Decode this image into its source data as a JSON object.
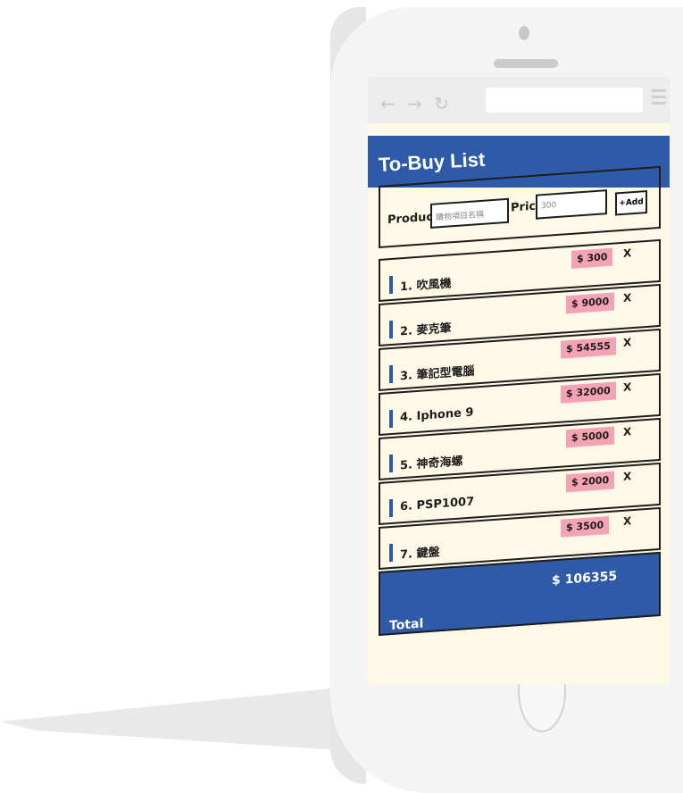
{
  "app": {
    "title": "To-Buy List"
  },
  "browser": {
    "back_icon": "arrow-left-icon",
    "forward_icon": "arrow-right-icon",
    "reload_icon": "reload-icon",
    "menu_icon": "hamburger-menu-icon"
  },
  "form": {
    "product_label": "Product",
    "product_placeholder": "購物項目名稱",
    "price_label": "Price",
    "price_value": "300",
    "add_label": "+Add"
  },
  "items": [
    {
      "name": "1. 吹風機",
      "price": "$ 300",
      "delete": "X"
    },
    {
      "name": "2. 麥克筆",
      "price": "$ 9000",
      "delete": "X"
    },
    {
      "name": "3. 筆記型電腦",
      "price": "$ 54555",
      "delete": "X"
    },
    {
      "name": "4. Iphone 9",
      "price": "$ 32000",
      "delete": "X"
    },
    {
      "name": "5. 神奇海螺",
      "price": "$ 5000",
      "delete": "X"
    },
    {
      "name": "6. PSP1007",
      "price": "$ 2000",
      "delete": "X"
    },
    {
      "name": "7. 鍵盤",
      "price": "$ 3500",
      "delete": "X"
    }
  ],
  "total": {
    "label": "Total",
    "value": "$ 106355"
  },
  "colors": {
    "primary": "#2e5aa8",
    "background": "#fdf9e6",
    "price_tag": "#f3a3b5",
    "border": "#1d1d1d"
  }
}
